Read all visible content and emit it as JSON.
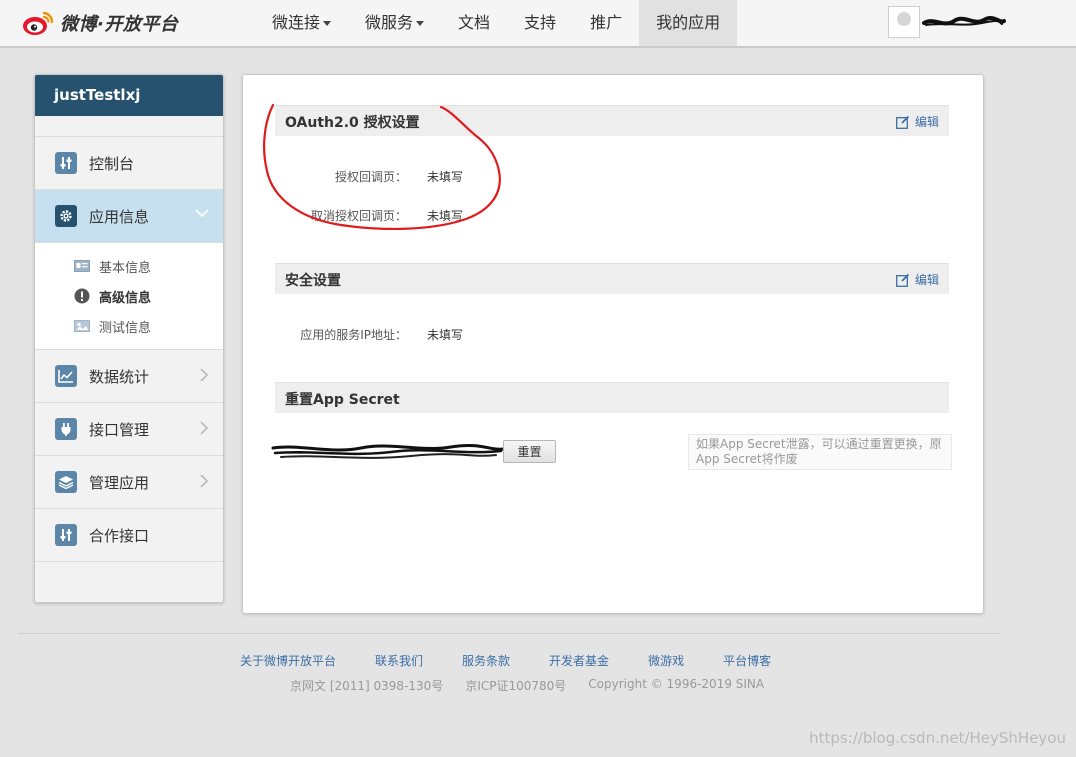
{
  "header": {
    "logo_text": "微博·开放平台",
    "nav": [
      {
        "label": "微连接",
        "dropdown": true
      },
      {
        "label": "微服务",
        "dropdown": true
      },
      {
        "label": "文档",
        "dropdown": false
      },
      {
        "label": "支持",
        "dropdown": false
      },
      {
        "label": "推广",
        "dropdown": false
      },
      {
        "label": "我的应用",
        "dropdown": false,
        "active": true
      }
    ]
  },
  "sidebar": {
    "app_name": "justTestlxj",
    "items": [
      {
        "label": "控制台",
        "icon": "sliders-icon"
      },
      {
        "label": "应用信息",
        "icon": "gear-icon",
        "active": true,
        "expanded": true
      },
      {
        "label": "数据统计",
        "icon": "chart-icon"
      },
      {
        "label": "接口管理",
        "icon": "plug-icon"
      },
      {
        "label": "管理应用",
        "icon": "layers-icon"
      },
      {
        "label": "合作接口",
        "icon": "sliders-icon"
      }
    ],
    "subitems": [
      {
        "label": "基本信息",
        "icon": "id-card-icon"
      },
      {
        "label": "高级信息",
        "icon": "exclamation-icon",
        "current": true
      },
      {
        "label": "测试信息",
        "icon": "image-icon"
      }
    ]
  },
  "oauth": {
    "title": "OAuth2.0 授权设置",
    "edit_label": "编辑",
    "callback_label": "授权回调页：",
    "callback_value": "未填写",
    "cancel_callback_label": "取消授权回调页：",
    "cancel_callback_value": "未填写"
  },
  "security": {
    "title": "安全设置",
    "edit_label": "编辑",
    "ip_label": "应用的服务IP地址：",
    "ip_value": "未填写"
  },
  "secret": {
    "title": "重置App Secret",
    "reset_label": "重置",
    "hint": "如果App Secret泄露，可以通过重置更换，原App Secret将作废"
  },
  "footer": {
    "links": [
      "关于微博开放平台",
      "联系我们",
      "服务条款",
      "开发者基金",
      "微游戏",
      "平台博客"
    ],
    "license": "京网文 [2011] 0398-130号",
    "icp": "京ICP证100780号",
    "copyright": "Copyright © 1996-2019 SINA"
  },
  "watermark": "https://blog.csdn.net/HeyShHeyou",
  "colors": {
    "sidebar_header": "#27526f",
    "active_item": "#c7e0f0",
    "link": "#3b6ea5",
    "annotation": "#e01b1b"
  }
}
